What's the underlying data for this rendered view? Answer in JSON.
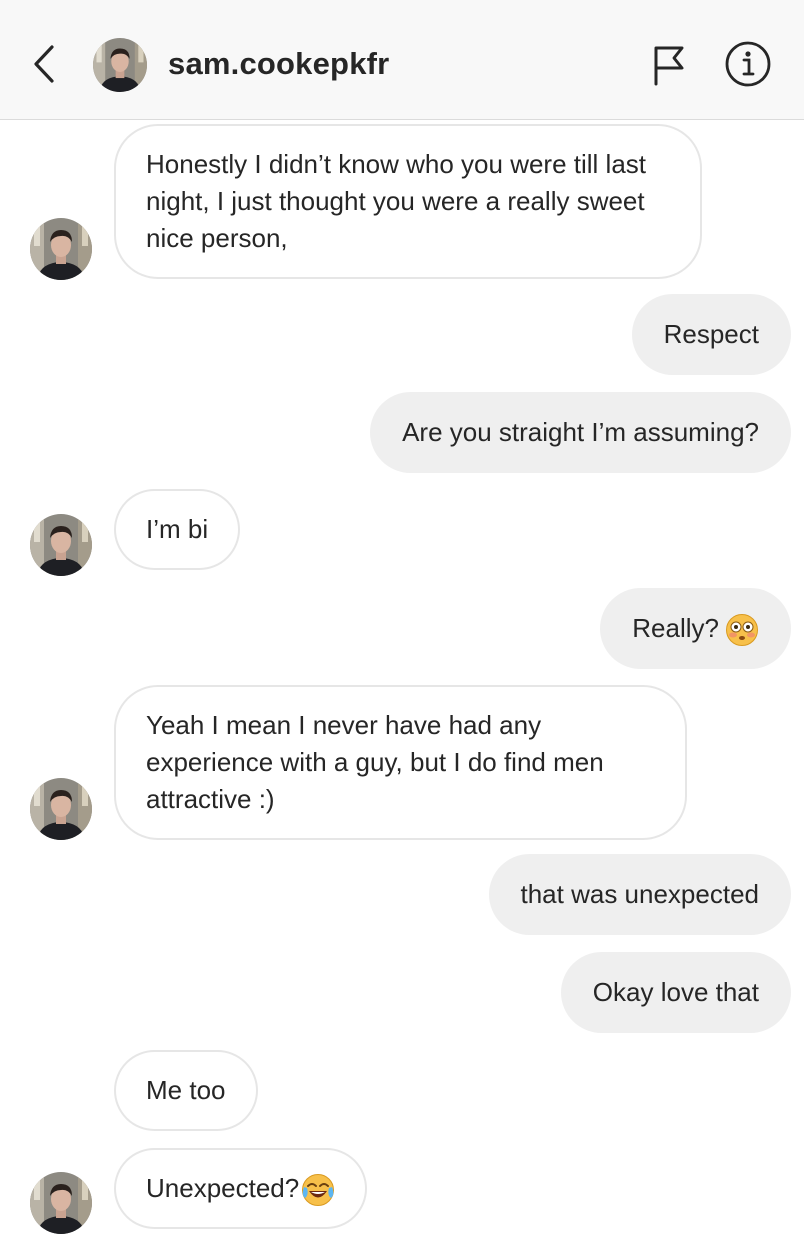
{
  "header": {
    "username": "sam.cookepkfr",
    "back_icon": "chevron-left-icon",
    "flag_icon": "flag-icon",
    "info_icon": "info-icon"
  },
  "messages": [
    {
      "from": "them",
      "text": "Honestly I didn’t know who you were till last night, I just thought you were a really sweet nice person,"
    },
    {
      "from": "me",
      "text": "Respect"
    },
    {
      "from": "me",
      "text": "Are you straight I’m assuming?"
    },
    {
      "from": "them",
      "text": "I’m bi"
    },
    {
      "from": "me",
      "text": "Really?",
      "emoji": "flushed-face-emoji"
    },
    {
      "from": "them",
      "text": "Yeah I mean I never have had any experience with a guy, but I do find men attractive :)"
    },
    {
      "from": "me",
      "text": "that was unexpected"
    },
    {
      "from": "me",
      "text": "Okay love that"
    },
    {
      "from": "them",
      "text": "Me too"
    },
    {
      "from": "them",
      "text": "Unexpected?",
      "emoji": "tears-of-joy-emoji"
    }
  ]
}
